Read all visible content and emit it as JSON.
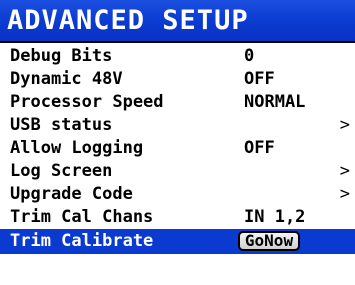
{
  "header": {
    "title": "ADVANCED SETUP"
  },
  "menu": {
    "items": [
      {
        "label": "Debug Bits",
        "value": "0",
        "chevron": ""
      },
      {
        "label": "Dynamic 48V",
        "value": "OFF",
        "chevron": ""
      },
      {
        "label": "Processor Speed",
        "value": "NORMAL",
        "chevron": ""
      },
      {
        "label": "USB status",
        "value": "",
        "chevron": ">"
      },
      {
        "label": "Allow Logging",
        "value": "OFF",
        "chevron": ""
      },
      {
        "label": "Log Screen",
        "value": "",
        "chevron": ">"
      },
      {
        "label": "Upgrade Code",
        "value": "",
        "chevron": ">"
      },
      {
        "label": "Trim Cal Chans",
        "value": "IN 1,2",
        "chevron": ""
      },
      {
        "label": "Trim Calibrate",
        "button": "GoNow",
        "selected": true
      }
    ]
  },
  "colors": {
    "title_bar": "#0a3ad0",
    "selected_row": "#0a3ad0",
    "text": "#000000",
    "title_text": "#ffffff"
  }
}
